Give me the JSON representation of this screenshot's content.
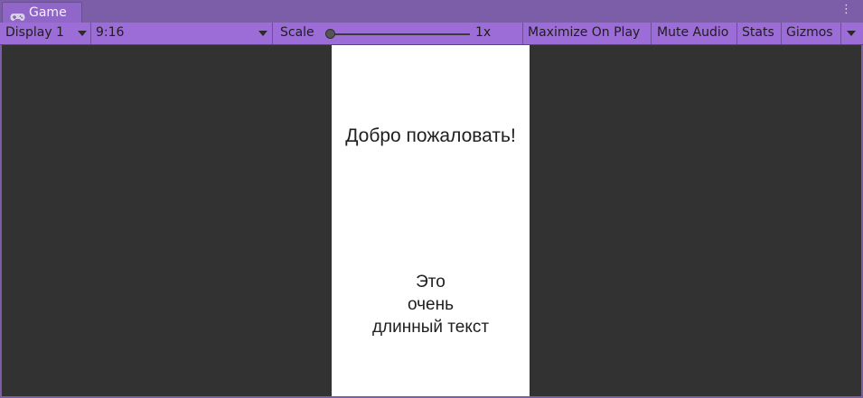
{
  "tab": {
    "label": "Game",
    "icon": "gamepad-icon"
  },
  "menu": {
    "icon": "kebab-menu-icon",
    "glyph": "⋮"
  },
  "toolbar": {
    "display": "Display 1",
    "aspect": "9:16",
    "scale_label": "Scale",
    "scale_value": "1x",
    "scale_level": 0,
    "maximize_on_play": "Maximize On Play",
    "mute_audio": "Mute Audio",
    "stats": "Stats",
    "gizmos": "Gizmos"
  },
  "game_view": {
    "welcome_text": "Добро пожаловать!",
    "long_text_lines": [
      "Это",
      "очень",
      "длинный текст"
    ]
  },
  "colors": {
    "window_bg": "#7b5ea7",
    "toolbar_bg": "#9c6dd6",
    "viewport_bg": "#323232",
    "screen_bg": "#ffffff"
  }
}
